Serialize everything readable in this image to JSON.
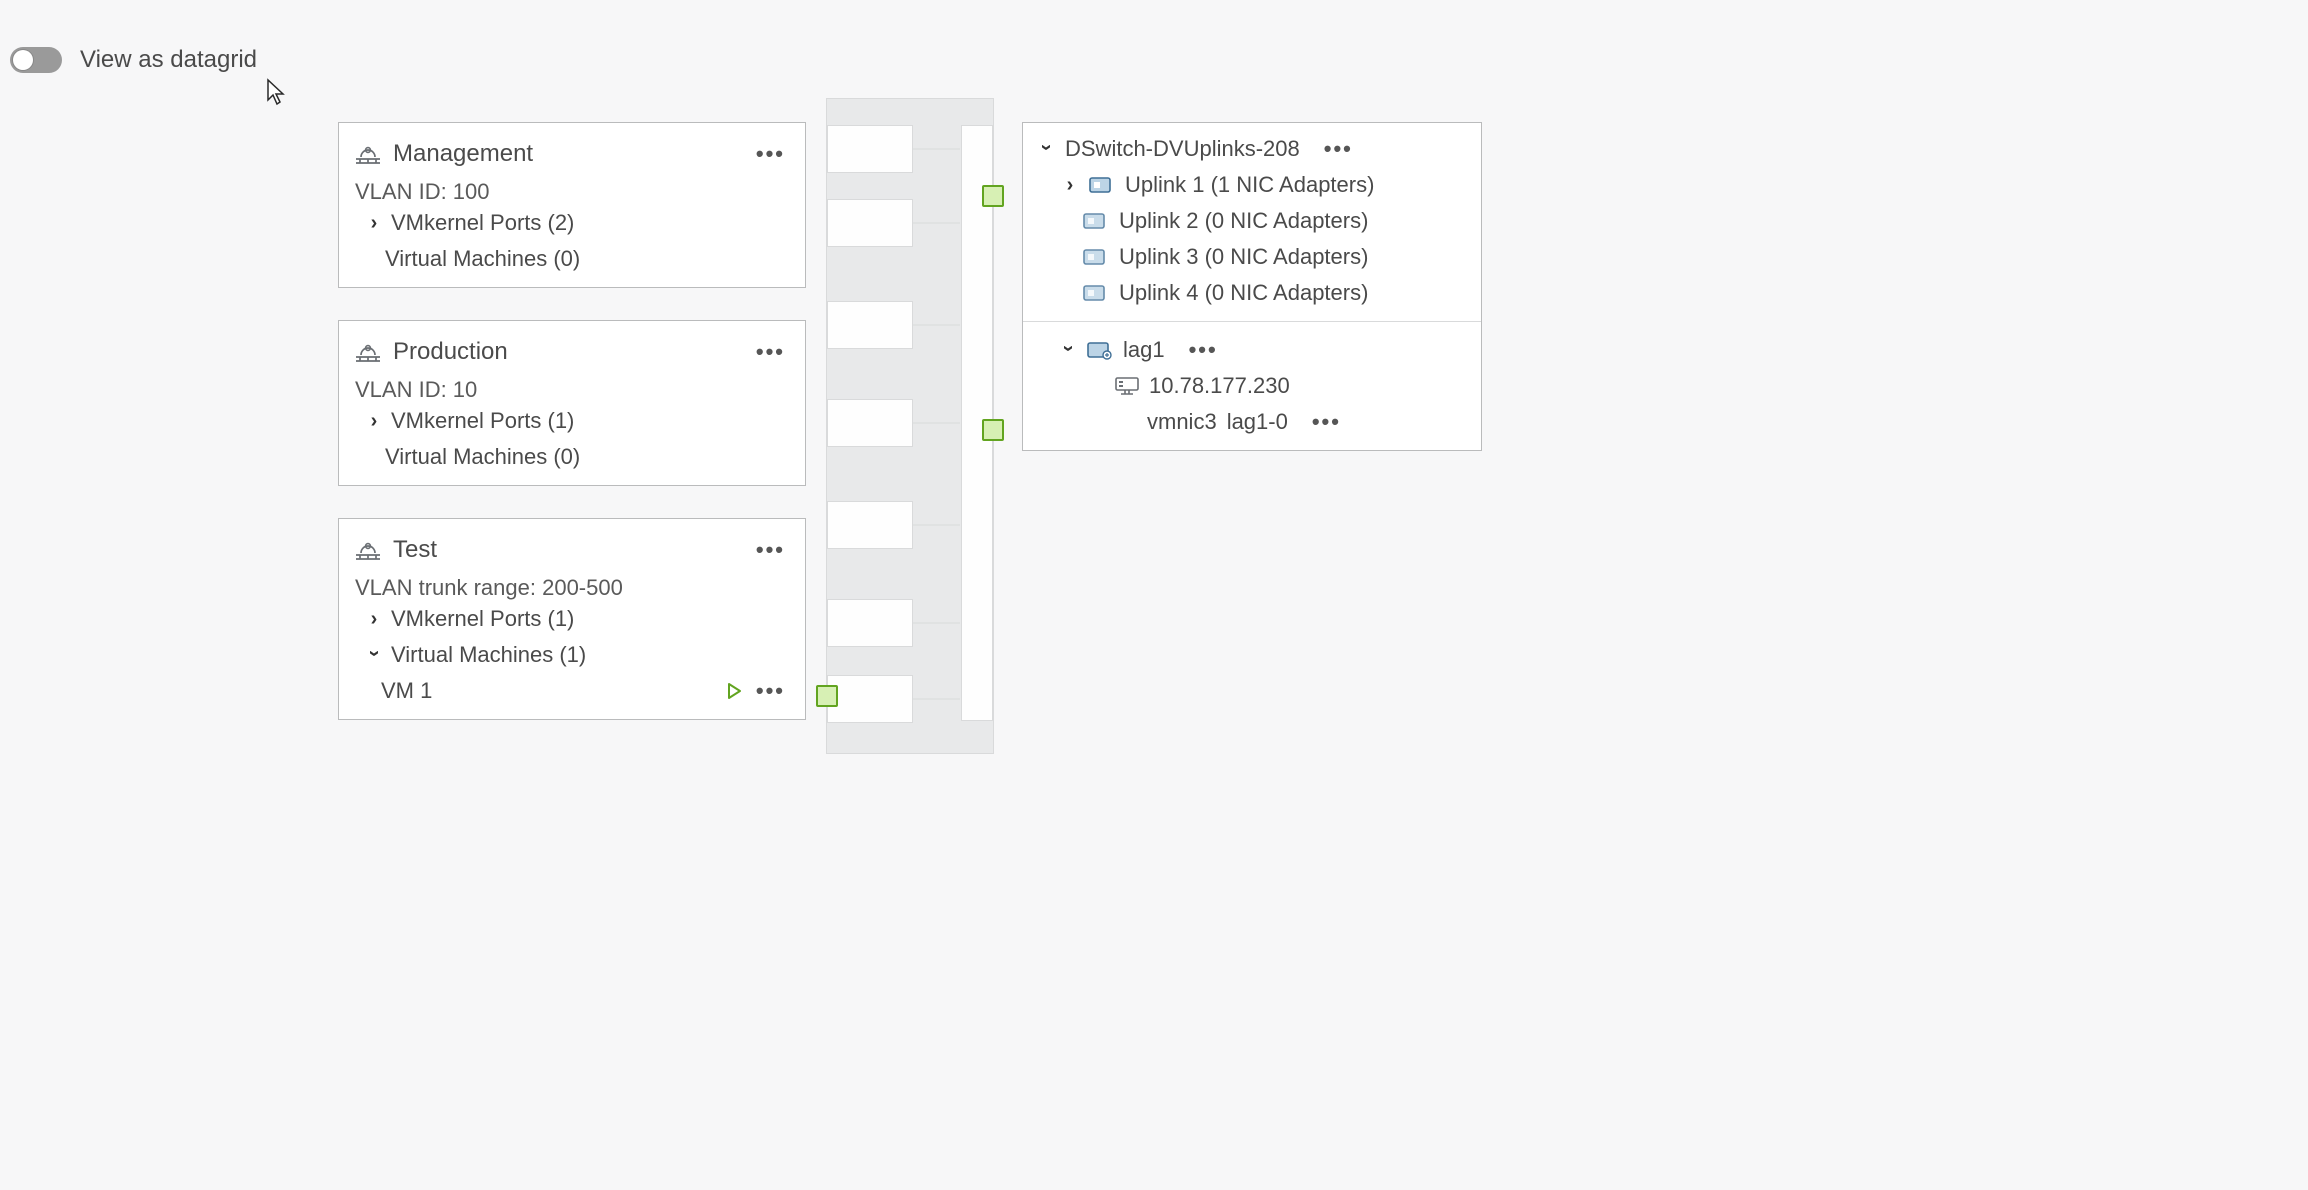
{
  "toggle": {
    "label": "View as datagrid",
    "checked": false
  },
  "portgroups": [
    {
      "title": "Management",
      "subline": "VLAN ID: 100",
      "children": [
        {
          "type": "group",
          "label": "VMkernel Ports (2)",
          "expanded": false
        },
        {
          "type": "group",
          "label": "Virtual Machines (0)",
          "expanded": false,
          "no_caret": true
        }
      ]
    },
    {
      "title": "Production",
      "subline": "VLAN ID: 10",
      "children": [
        {
          "type": "group",
          "label": "VMkernel Ports (1)",
          "expanded": false
        },
        {
          "type": "group",
          "label": "Virtual Machines (0)",
          "expanded": false,
          "no_caret": true
        }
      ]
    },
    {
      "title": "Test",
      "subline": "VLAN trunk range: 200-500",
      "children": [
        {
          "type": "group",
          "label": "VMkernel Ports (1)",
          "expanded": false
        },
        {
          "type": "group",
          "label": "Virtual Machines (1)",
          "expanded": true,
          "items": [
            {
              "label": "VM 1",
              "state": "running"
            }
          ]
        }
      ]
    }
  ],
  "uplinks_card": {
    "title": "DSwitch-DVUplinks-208",
    "title_expanded": true,
    "uplinks": [
      {
        "label": "Uplink 1 (1 NIC Adapters)",
        "caret": true
      },
      {
        "label": "Uplink 2 (0 NIC Adapters)",
        "caret": false
      },
      {
        "label": "Uplink 3 (0 NIC Adapters)",
        "caret": false
      },
      {
        "label": "Uplink 4 (0 NIC Adapters)",
        "caret": false
      }
    ],
    "lag": {
      "name": "lag1",
      "expanded": true,
      "host_ip": "10.78.177.230",
      "nic": {
        "physnic": "vmnic3",
        "lane": "lag1-0"
      }
    }
  }
}
